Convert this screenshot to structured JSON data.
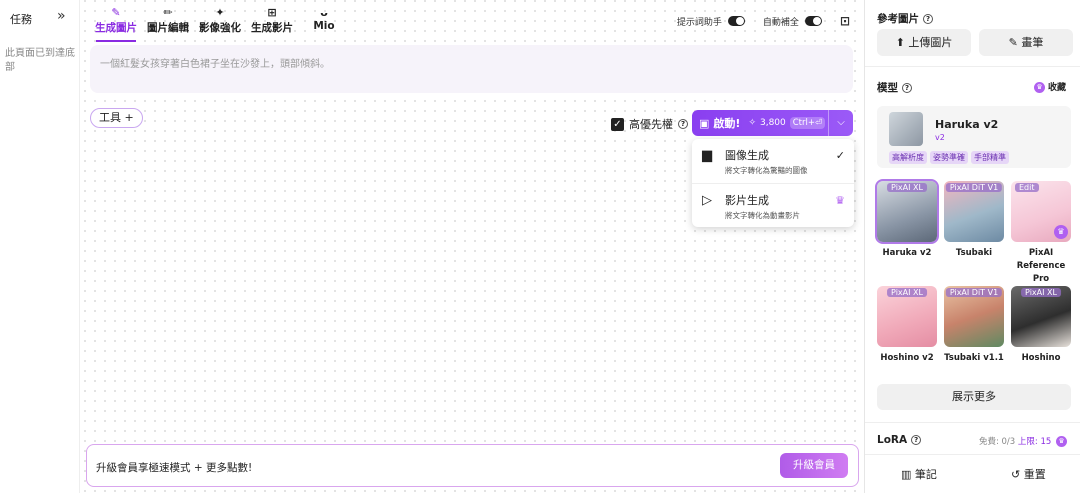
{
  "left": {
    "title": "任務",
    "empty": "此頁面已到達底部"
  },
  "tabs": [
    {
      "label": "生成圖片",
      "icon": "✎"
    },
    {
      "label": "圖片編輯",
      "icon": "✏"
    },
    {
      "label": "影像強化",
      "icon": "✦"
    },
    {
      "label": "生成影片",
      "icon": "⊞"
    },
    {
      "label": "Mio",
      "icon": "ᴗ"
    }
  ],
  "topbar": {
    "prompt_helper": "提示詞助手",
    "auto_complete": "自動補全"
  },
  "prompt": {
    "text": "一個紅髮女孩穿著白色裙子坐在沙發上，頭部傾斜。"
  },
  "tools_label": "工具 +",
  "priority_label": "高優先權",
  "launch": {
    "label": "啟動!",
    "cost": "3,800",
    "shortcut": "Ctrl+⏎"
  },
  "menu": [
    {
      "title": "圖像生成",
      "subtitle": "將文字轉化為驚豔的圖像",
      "right": "✓"
    },
    {
      "title": "影片生成",
      "subtitle": "將文字轉化為動畫影片",
      "right": "♛"
    }
  ],
  "upgrade": {
    "text": "升級會員享極速模式 + 更多點數!",
    "button": "升級會員"
  },
  "right": {
    "ref_title": "參考圖片",
    "upload": "上傳圖片",
    "brush": "畫筆",
    "model_title": "模型",
    "favorites": "收藏",
    "selected": {
      "name": "Haruka v2",
      "version": "v2",
      "tags": [
        "高解析度",
        "姿勢準確",
        "手部精準"
      ]
    },
    "models": [
      {
        "name": "Haruka v2",
        "badge": "PixAI XL"
      },
      {
        "name": "Tsubaki",
        "badge": "PixAI DiT V1"
      },
      {
        "name": "PixAI Reference Pro",
        "badge": "Edit"
      },
      {
        "name": "Hoshino v2",
        "badge": "PixAI XL"
      },
      {
        "name": "Tsubaki v1.1",
        "badge": "PixAI DiT V1"
      },
      {
        "name": "Hoshino",
        "badge": "PixAI XL"
      }
    ],
    "show_more": "展示更多",
    "lora_title": "LoRA",
    "lora_free": "免費: 0/3",
    "lora_limit": "上限: 15",
    "notes": "筆記",
    "reset": "重置"
  },
  "colors": {
    "accent": "#8a2be2",
    "upgrade": "#c46ef0"
  }
}
